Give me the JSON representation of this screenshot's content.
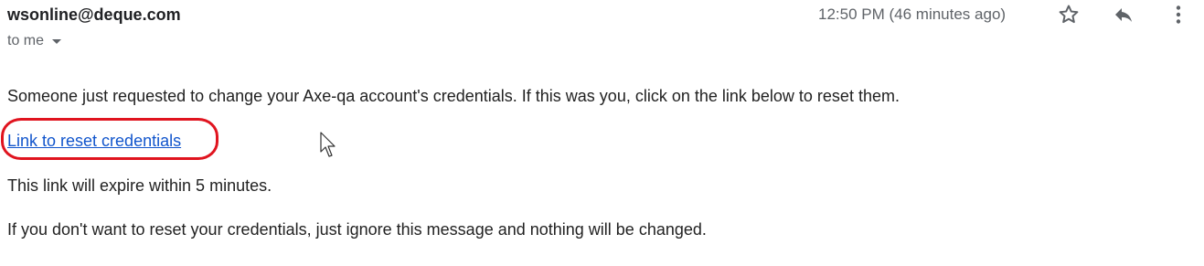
{
  "header": {
    "sender": "wsonline@deque.com",
    "recipient_label": "to me",
    "timestamp": "12:50 PM (46 minutes ago)",
    "icons": {
      "recipient_details": "chevron-down-icon",
      "star": "star-icon",
      "reply": "reply-icon",
      "more": "more-vert-icon"
    }
  },
  "body": {
    "intro": "Someone just requested to change your Axe-qa account's credentials. If this was you, click on the link below to reset them.",
    "reset_link": "Link to reset credentials",
    "expiry_notice": "This link will expire within 5 minutes.",
    "ignore_notice": "If you don't want to reset your credentials, just ignore this message and nothing will be changed."
  },
  "colors": {
    "link": "#1155cc",
    "highlight": "#e0141f",
    "muted": "#5f6368",
    "text": "#222222"
  }
}
